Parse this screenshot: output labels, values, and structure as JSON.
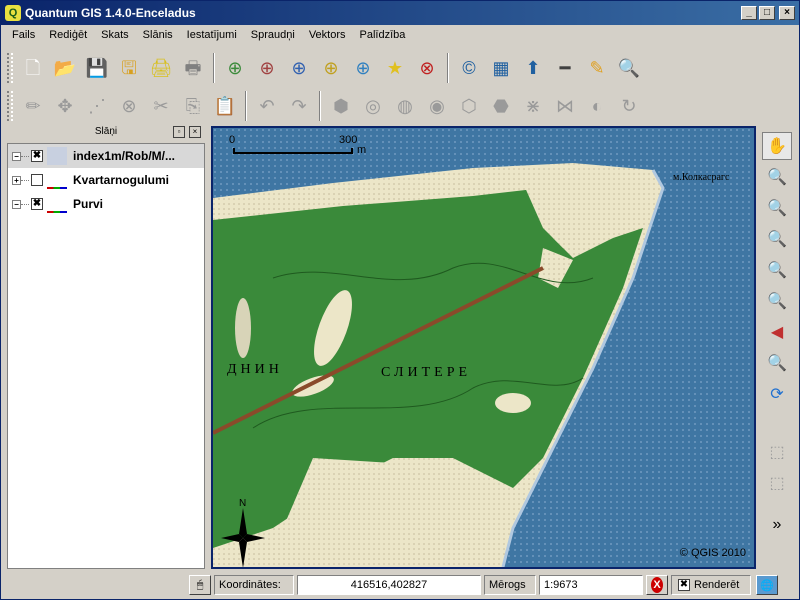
{
  "window": {
    "title": "Quantum GIS 1.4.0-Enceladus",
    "controls": [
      "_",
      "□",
      "×"
    ]
  },
  "menubar": [
    "Fails",
    "Rediģēt",
    "Skats",
    "Slānis",
    "Iestatījumi",
    "Spraudņi",
    "Vektors",
    "Palīdzība"
  ],
  "toolbar1": [
    {
      "name": "new-project-icon",
      "glyph": "🗋",
      "color": "#ffffff"
    },
    {
      "name": "open-project-icon",
      "glyph": "📂",
      "color": "#4a7fc0"
    },
    {
      "name": "save-project-icon",
      "glyph": "💾",
      "color": "#3a5f9a"
    },
    {
      "name": "save-as-icon",
      "glyph": "🖫",
      "color": "#d8a020"
    },
    {
      "name": "new-print-composer-icon",
      "glyph": "🖨",
      "color": "#d8c020"
    },
    {
      "name": "print-icon",
      "glyph": "🖶",
      "color": "#808080"
    },
    {
      "name": "add-vector-layer-icon",
      "glyph": "⊕",
      "color": "#3a8a3a"
    },
    {
      "name": "add-raster-layer-icon",
      "glyph": "⊕",
      "color": "#a04040"
    },
    {
      "name": "add-postgis-layer-icon",
      "glyph": "⊕",
      "color": "#3060b0"
    },
    {
      "name": "add-spatialite-layer-icon",
      "glyph": "⊕",
      "color": "#c0a020"
    },
    {
      "name": "add-wms-layer-icon",
      "glyph": "⊕",
      "color": "#3080c0"
    },
    {
      "name": "new-vector-layer-icon",
      "glyph": "★",
      "color": "#e0c020"
    },
    {
      "name": "remove-layer-icon",
      "glyph": "⊗",
      "color": "#c02020"
    },
    {
      "name": "copyright-label-icon",
      "glyph": "©",
      "color": "#2060a0"
    },
    {
      "name": "scale-bar-decoration-icon",
      "glyph": "▦",
      "color": "#2060a0"
    },
    {
      "name": "north-arrow-icon",
      "glyph": "⬆",
      "color": "#2060a0"
    },
    {
      "name": "scale-bar-icon",
      "glyph": "━",
      "color": "#404040"
    },
    {
      "name": "annotation-icon",
      "glyph": "✎",
      "color": "#e0a020"
    },
    {
      "name": "identify-icon",
      "glyph": "🔍",
      "color": "#3060b0"
    }
  ],
  "toolbar2": [
    {
      "name": "toggle-editing-icon",
      "glyph": "✏"
    },
    {
      "name": "move-feature-icon",
      "glyph": "✥"
    },
    {
      "name": "node-tool-icon",
      "glyph": "⋰"
    },
    {
      "name": "delete-selected-icon",
      "glyph": "⊗"
    },
    {
      "name": "cut-features-icon",
      "glyph": "✂"
    },
    {
      "name": "copy-features-icon",
      "glyph": "⎘"
    },
    {
      "name": "paste-features-icon",
      "glyph": "📋"
    },
    {
      "name": "undo-icon",
      "glyph": "↶"
    },
    {
      "name": "redo-icon",
      "glyph": "↷"
    },
    {
      "name": "simplify-feature-icon",
      "glyph": "⬢"
    },
    {
      "name": "add-ring-icon",
      "glyph": "◎"
    },
    {
      "name": "add-island-icon",
      "glyph": "◍"
    },
    {
      "name": "delete-ring-icon",
      "glyph": "◉"
    },
    {
      "name": "delete-part-icon",
      "glyph": "⬡"
    },
    {
      "name": "reshape-features-icon",
      "glyph": "⬣"
    },
    {
      "name": "split-features-icon",
      "glyph": "⋇"
    },
    {
      "name": "merge-features-icon",
      "glyph": "⋈"
    },
    {
      "name": "offset-curve-icon",
      "glyph": "◐"
    },
    {
      "name": "rotate-point-symbols-icon",
      "glyph": "↻"
    }
  ],
  "layers": {
    "title": "Slāņi",
    "items": [
      {
        "label": "index1m/Rob/M/...",
        "checked": "✖",
        "expander": "−",
        "selected": true
      },
      {
        "label": "Kvartarnogulumi",
        "checked": "",
        "expander": "+",
        "selected": false
      },
      {
        "label": "Purvi",
        "checked": "✖",
        "expander": "−",
        "selected": false
      }
    ]
  },
  "map": {
    "scale_start": "0",
    "scale_end": "300",
    "scale_unit": "m",
    "copyright": "© QGIS 2010",
    "map_text_1": "ДНИН",
    "map_text_2": "СЛИТЕРЕ",
    "place_label": "м.Колкасрагс"
  },
  "maptools": [
    {
      "name": "pan-tool-icon",
      "glyph": "✋",
      "active": true,
      "color": "#000000"
    },
    {
      "name": "zoom-in-icon",
      "glyph": "🔍",
      "color": "#3a8a3a"
    },
    {
      "name": "zoom-out-icon",
      "glyph": "🔍",
      "color": "#3a8a3a"
    },
    {
      "name": "zoom-full-icon",
      "glyph": "🔍",
      "color": "#c03030"
    },
    {
      "name": "zoom-to-layer-icon",
      "glyph": "🔍",
      "color": "#c0a020"
    },
    {
      "name": "zoom-to-selection-icon",
      "glyph": "🔍",
      "color": "#3060b0"
    },
    {
      "name": "zoom-last-icon",
      "glyph": "◀",
      "color": "#c03030"
    },
    {
      "name": "zoom-next-icon",
      "glyph": "🔍",
      "color": "#9a9a9a",
      "disabled": true
    },
    {
      "name": "refresh-icon",
      "glyph": "⟳",
      "color": "#2070d0"
    },
    {
      "name": "select-features-icon",
      "glyph": "⬚",
      "color": "#9a9a9a",
      "disabled": true
    },
    {
      "name": "deselect-icon",
      "glyph": "⬚",
      "color": "#9a9a9a",
      "disabled": true
    },
    {
      "name": "more-tools-icon",
      "glyph": "»",
      "color": "#000000"
    }
  ],
  "statusbar": {
    "coordinates_label": "Koordinātes:",
    "coordinates_value": "416516,402827",
    "scale_label": "Mērogs",
    "scale_value": "1:9673",
    "render_label": "Renderēt",
    "render_checked": "✖",
    "stop_icon": "X"
  },
  "colors": {
    "forest": "#3a8a3a",
    "sea": "#3f76a3",
    "sand": "#e8e4c8"
  }
}
